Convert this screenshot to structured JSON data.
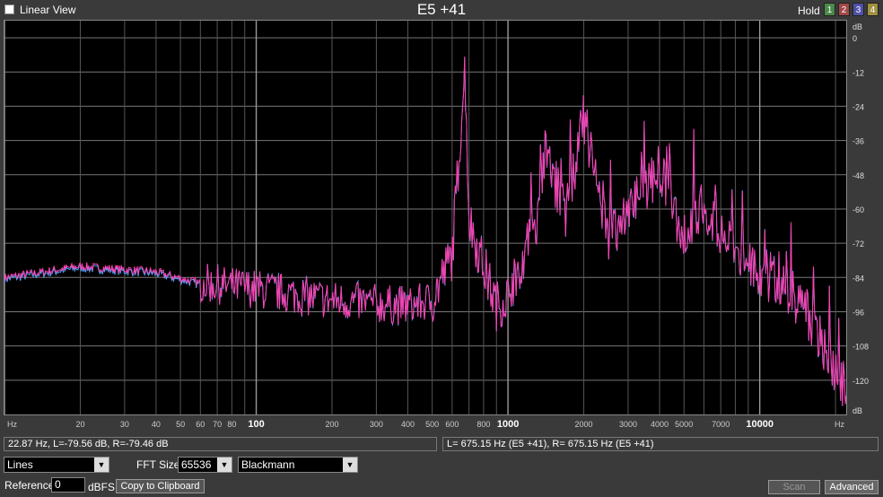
{
  "header": {
    "linear_view_label": "Linear View",
    "note": "E5 +41",
    "hold_label": "Hold",
    "hold_buttons": [
      {
        "label": "1",
        "color": "#4a8a4a"
      },
      {
        "label": "2",
        "color": "#a04848"
      },
      {
        "label": "3",
        "color": "#5050a8"
      },
      {
        "label": "4",
        "color": "#a09040"
      }
    ]
  },
  "chart_data": {
    "type": "line",
    "xscale": "log",
    "xlim": [
      10,
      22050
    ],
    "ylim": [
      -132,
      6
    ],
    "x_tick_labels": [
      {
        "v": 10,
        "t": "Hz"
      },
      {
        "v": 20,
        "t": "20"
      },
      {
        "v": 30,
        "t": "30"
      },
      {
        "v": 40,
        "t": "40"
      },
      {
        "v": 50,
        "t": "50"
      },
      {
        "v": 60,
        "t": "60"
      },
      {
        "v": 70,
        "t": "70"
      },
      {
        "v": 80,
        "t": "80"
      },
      {
        "v": 100,
        "t": "100"
      },
      {
        "v": 200,
        "t": "200"
      },
      {
        "v": 300,
        "t": "300"
      },
      {
        "v": 400,
        "t": "400"
      },
      {
        "v": 500,
        "t": "500"
      },
      {
        "v": 600,
        "t": "600"
      },
      {
        "v": 800,
        "t": "800"
      },
      {
        "v": 1000,
        "t": "1000"
      },
      {
        "v": 2000,
        "t": "2000"
      },
      {
        "v": 3000,
        "t": "3000"
      },
      {
        "v": 4000,
        "t": "4000"
      },
      {
        "v": 5000,
        "t": "5000"
      },
      {
        "v": 7000,
        "t": "7000"
      },
      {
        "v": 10000,
        "t": "10000"
      },
      {
        "v": 22050,
        "t": "Hz"
      }
    ],
    "y_ticks": [
      0,
      -12,
      -24,
      -36,
      -48,
      -60,
      -72,
      -84,
      -96,
      -108,
      -120
    ],
    "y_top_label": "dB",
    "y_bottom_label": "dB",
    "grid": true,
    "series_colors": {
      "left": "#4aa8ff",
      "right": "#ff3fb0"
    },
    "key_points": [
      [
        10,
        -84
      ],
      [
        20,
        -80
      ],
      [
        40,
        -82
      ],
      [
        60,
        -86
      ],
      [
        100,
        -88
      ],
      [
        200,
        -92
      ],
      [
        400,
        -94
      ],
      [
        500,
        -92
      ],
      [
        600,
        -76
      ],
      [
        675,
        -10
      ],
      [
        700,
        -64
      ],
      [
        800,
        -80
      ],
      [
        900,
        -94
      ],
      [
        1000,
        -90
      ],
      [
        1300,
        -64
      ],
      [
        1400,
        -40
      ],
      [
        1700,
        -62
      ],
      [
        2000,
        -28
      ],
      [
        2500,
        -70
      ],
      [
        3000,
        -60
      ],
      [
        4000,
        -46
      ],
      [
        5000,
        -70
      ],
      [
        6000,
        -58
      ],
      [
        8000,
        -76
      ],
      [
        10000,
        -82
      ],
      [
        12000,
        -86
      ],
      [
        15000,
        -94
      ],
      [
        18000,
        -108
      ],
      [
        22050,
        -124
      ]
    ]
  },
  "status": {
    "left": "22.87 Hz, L=-79.56 dB, R=-79.46 dB",
    "right": "L= 675.15 Hz (E5 +41), R= 675.15 Hz (E5 +41)"
  },
  "controls": {
    "display_mode": "Lines",
    "fft_size_label": "FFT Size",
    "fft_size": "65536",
    "window": "Blackmann",
    "reference_label": "Reference",
    "reference_value": "0",
    "reference_unit": "dBFS",
    "copy_button": "Copy to Clipboard",
    "scan_button": "Scan",
    "advanced_button": "Advanced"
  }
}
